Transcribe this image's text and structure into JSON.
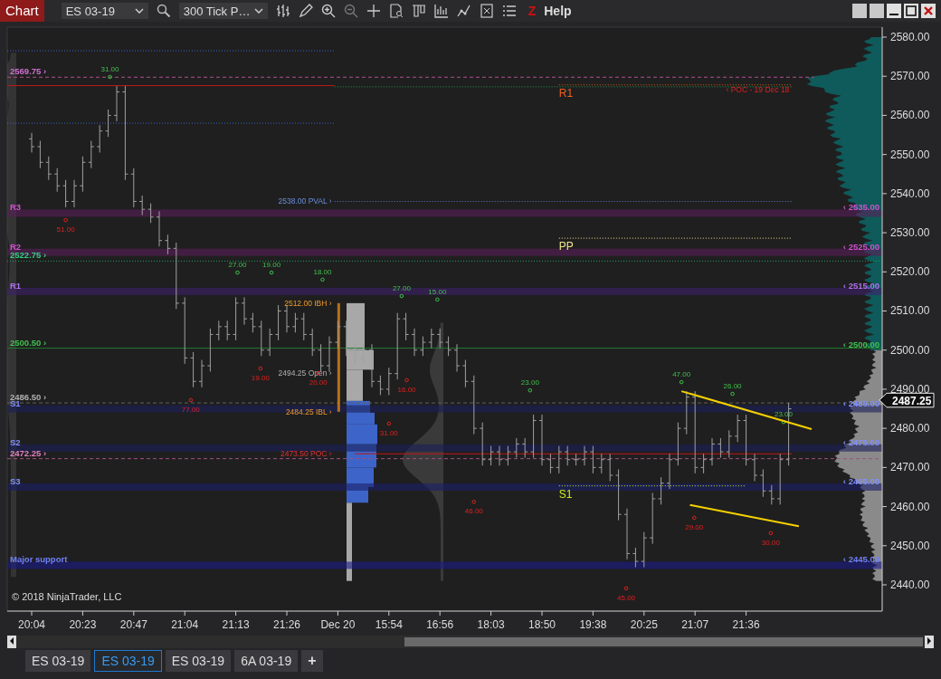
{
  "toolbar": {
    "title": "Chart",
    "instrument": "ES 03-19",
    "interval": "300 Tick P…",
    "logo": "Z",
    "help": "Help"
  },
  "chart": {
    "copyright": "© 2018 NinjaTrader, LLC",
    "last_price": "2487.25",
    "price_axis": [
      "2580.00",
      "2570.00",
      "2560.00",
      "2550.00",
      "2540.00",
      "2530.00",
      "2520.00",
      "2510.00",
      "2500.00",
      "2490.00",
      "2480.00",
      "2470.00",
      "2460.00",
      "2450.00",
      "2440.00"
    ],
    "time_axis": [
      "20:04",
      "20:23",
      "20:47",
      "21:04",
      "21:13",
      "21:26",
      "Dec 20",
      "15:54",
      "16:56",
      "18:03",
      "18:50",
      "19:38",
      "20:25",
      "21:07",
      "21:36"
    ],
    "levels": [
      "2569.75 ›",
      "R1",
      "‹ POC - 19 Dec 18",
      "2538.00 PVAL ›",
      "R3",
      "‹ 2535.00",
      "R2",
      "PP",
      "‹ 2525.00",
      "2522.75 ›",
      "R1",
      "‹ 2515.00",
      "2512.00 IBH ›",
      "2500.50 ›",
      "‹ 2500.00",
      "2494.25 Open ›",
      "2486.50 ›",
      "S1",
      "2484.25 IBL ›",
      "‹ 2485.00",
      "S2",
      "2473.50 POC ›",
      "‹ 2475.00",
      "2472.25 ›",
      "S3",
      "S1",
      "‹ 2465.00",
      "Major support",
      "‹ 2445.00"
    ],
    "swings": [
      {
        "text": "31.00",
        "kind": "high"
      },
      {
        "text": "51.00",
        "kind": "low"
      },
      {
        "text": "27.00",
        "kind": "high"
      },
      {
        "text": "19.00",
        "kind": "high"
      },
      {
        "text": "18.00",
        "kind": "high"
      },
      {
        "text": "27.00",
        "kind": "high"
      },
      {
        "text": "15.00",
        "kind": "high"
      },
      {
        "text": "23.00",
        "kind": "high"
      },
      {
        "text": "47.00",
        "kind": "high"
      },
      {
        "text": "26.00",
        "kind": "high"
      },
      {
        "text": "23.00",
        "kind": "high"
      },
      {
        "text": "77.00",
        "kind": "low"
      },
      {
        "text": "19.00",
        "kind": "low"
      },
      {
        "text": "20.00",
        "kind": "low"
      },
      {
        "text": "16.00",
        "kind": "low"
      },
      {
        "text": "31.00",
        "kind": "low"
      },
      {
        "text": "46.00",
        "kind": "low"
      },
      {
        "text": "29.00",
        "kind": "low"
      },
      {
        "text": "30.00",
        "kind": "low"
      },
      {
        "text": "45.00",
        "kind": "low"
      }
    ]
  },
  "tabs": [
    {
      "label": "ES 03-19",
      "selected": false
    },
    {
      "label": "ES 03-19",
      "selected": true
    },
    {
      "label": "ES 03-19",
      "selected": false
    },
    {
      "label": "6A 03-19",
      "selected": false
    }
  ],
  "add_tab": "+"
}
